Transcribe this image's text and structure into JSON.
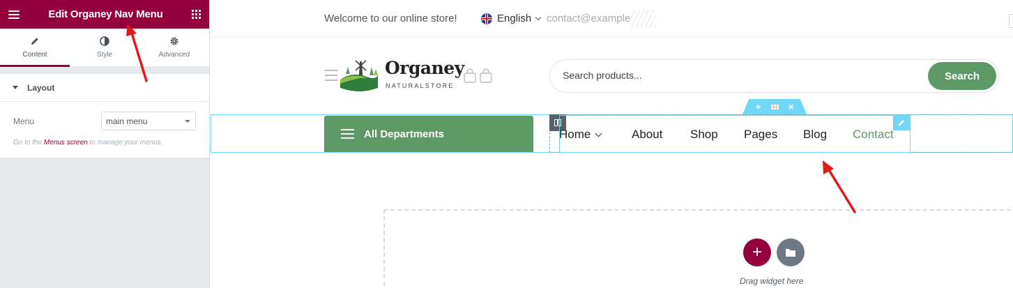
{
  "panel": {
    "header_title": "Edit Organey Nav Menu",
    "tabs": [
      {
        "label": "Content",
        "icon": "pencil-icon",
        "active": true
      },
      {
        "label": "Style",
        "icon": "half-circle-icon",
        "active": false
      },
      {
        "label": "Advanced",
        "icon": "gear-icon",
        "active": false
      }
    ],
    "section_title": "Layout",
    "menu_label": "Menu",
    "menu_value": "main menu",
    "desc_prefix": "Go to the",
    "desc_link": "Menus screen",
    "desc_suffix": "to manage your menus.",
    "accent_color": "#93003c"
  },
  "topbar": {
    "welcome": "Welcome to our online store!",
    "language": "English",
    "email": "contact@example"
  },
  "header": {
    "logo_name": "Organey",
    "logo_sub": "NATURALSTORE",
    "search_placeholder": "Search products...",
    "search_button": "Search"
  },
  "nav": {
    "departments": "All Departments",
    "items": [
      "Home",
      "About",
      "Shop",
      "Pages",
      "Blog",
      "Contact"
    ],
    "active_item": "Contact",
    "brand_green": "#5d9964"
  },
  "editor": {
    "section_tab_plus": "+",
    "section_tab_close": "×",
    "drop_hint": "Drag widget here",
    "add_button": "+"
  }
}
